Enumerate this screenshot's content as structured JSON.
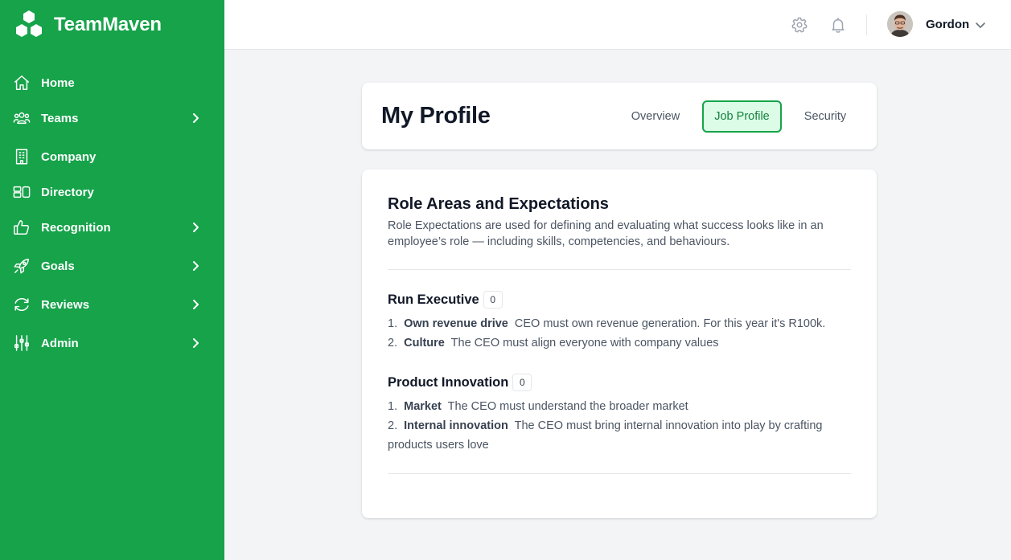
{
  "app": {
    "name": "TeamMaven"
  },
  "sidebar": {
    "items": [
      {
        "label": "Home",
        "icon": "home-icon",
        "has_submenu": false
      },
      {
        "label": "Teams",
        "icon": "users-icon",
        "has_submenu": true
      },
      {
        "label": "Company",
        "icon": "building-icon",
        "has_submenu": false
      },
      {
        "label": "Directory",
        "icon": "directory-icon",
        "has_submenu": false
      },
      {
        "label": "Recognition",
        "icon": "thumbs-up-icon",
        "has_submenu": true
      },
      {
        "label": "Goals",
        "icon": "rocket-icon",
        "has_submenu": true
      },
      {
        "label": "Reviews",
        "icon": "refresh-icon",
        "has_submenu": true
      },
      {
        "label": "Admin",
        "icon": "sliders-icon",
        "has_submenu": true
      }
    ]
  },
  "topbar": {
    "settings_icon": "gear-icon",
    "notifications_icon": "bell-icon",
    "user": {
      "name": "Gordon"
    }
  },
  "profile": {
    "title": "My Profile",
    "tabs": [
      {
        "label": "Overview",
        "active": false
      },
      {
        "label": "Job Profile",
        "active": true
      },
      {
        "label": "Security",
        "active": false
      }
    ]
  },
  "role_section": {
    "title": "Role Areas and Expectations",
    "description": "Role Expectations are used for defining and evaluating what success looks like in an employee’s role — including skills, competencies, and behaviours.",
    "groups": [
      {
        "title": "Run Executive",
        "count": "0",
        "items": [
          {
            "num": "1.",
            "name": "Own revenue drive",
            "text": "CEO must own revenue generation. For this year it's R100k."
          },
          {
            "num": "2.",
            "name": "Culture",
            "text": "The CEO must align everyone with company values"
          }
        ]
      },
      {
        "title": "Product Innovation",
        "count": "0",
        "items": [
          {
            "num": "1.",
            "name": "Market",
            "text": "The CEO must understand the broader market"
          },
          {
            "num": "2.",
            "name": "Internal innovation",
            "text": "The CEO must bring internal innovation into play by crafting products users love"
          }
        ]
      }
    ]
  },
  "colors": {
    "brand": "#16a34a",
    "active_tab_bg": "#dcfce7",
    "page_bg": "#f3f4f6"
  }
}
